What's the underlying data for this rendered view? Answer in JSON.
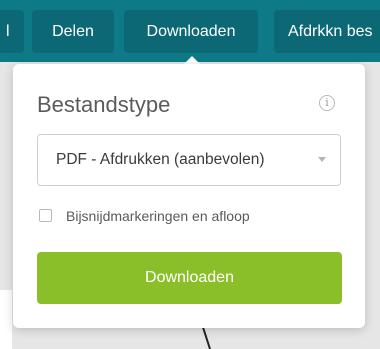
{
  "toolbar": {
    "tabs": [
      {
        "label": "l"
      },
      {
        "label": "Delen"
      },
      {
        "label": "Downloaden"
      },
      {
        "label": "Afdrkkn bes"
      }
    ]
  },
  "download_popover": {
    "title": "Bestandstype",
    "info_icon": "info-icon",
    "file_type_select": {
      "value": "PDF - Afdrukken (aanbevolen)"
    },
    "checkbox": {
      "label": "Bijsnijdmarkeringen en afloop",
      "checked": false
    },
    "download_button": {
      "label": "Downloaden"
    }
  },
  "colors": {
    "toolbar_bg": "#0e7a88",
    "tab_bg": "#0c6874",
    "button_green": "#8bbf2a"
  }
}
